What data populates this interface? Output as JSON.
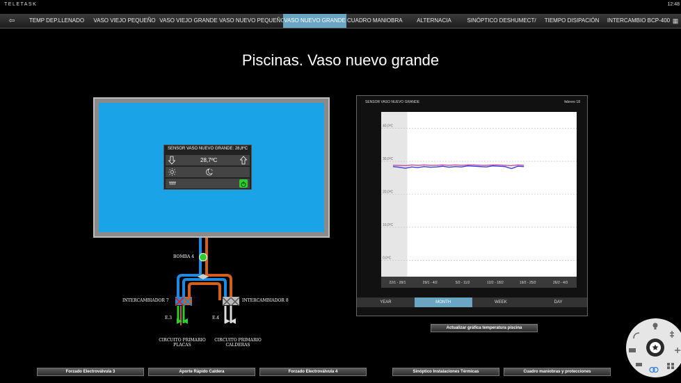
{
  "brand": "TELETASK",
  "clock": "12:48",
  "nav": {
    "tabs": [
      {
        "label": "TEMP DEP.LLENADO",
        "active": false
      },
      {
        "label": "VASO VIEJO PEQUEÑO",
        "active": false
      },
      {
        "label": "VASO VIEJO GRANDE",
        "active": false
      },
      {
        "label": "VASO NUEVO PEQUEÑO",
        "active": false
      },
      {
        "label": "VASO NUEVO GRANDE",
        "active": true
      },
      {
        "label": "CUADRO MANIOBRAS",
        "active": false
      },
      {
        "label": "ALTERNACIA",
        "active": false
      },
      {
        "label": "SINÓPTICO DESHUMECT/",
        "active": false
      },
      {
        "label": "TIEMPO DISIPACIÓN",
        "active": false
      },
      {
        "label": "INTERCAMBIO BCP-400",
        "active": false
      }
    ]
  },
  "page_title": "Piscinas. Vaso nuevo grande",
  "widget": {
    "title": "SENSOR VASO NUEVO GRANDE: 28,8ºC",
    "setpoint": "28,7ºC",
    "colors": {
      "power": "#2ecc2e",
      "bg": "#222222"
    }
  },
  "schematic": {
    "pump": "BOMBA 4",
    "hx7": "INTERCAMBIADOR 7",
    "hx8": "INTERCAMBIADOR 8",
    "e3": "E.3",
    "e4": "E.4",
    "circuit_a": [
      "CIRCUITO PRIMARIO",
      "PLACAS"
    ],
    "circuit_b": [
      "CIRCUITO PRIMARIO",
      "CALDERAS"
    ],
    "colors": {
      "hot": "#d2601c",
      "cold": "#1e8be0",
      "water": "#1aa3e6"
    }
  },
  "chart": {
    "header_left": "SENSOR VASO NUEVO GRANDE",
    "header_right": "febrero 18",
    "range_buttons": [
      {
        "label": "YEAR",
        "active": false
      },
      {
        "label": "MONTH",
        "active": true
      },
      {
        "label": "WEEK",
        "active": false
      },
      {
        "label": "DAY",
        "active": false
      }
    ]
  },
  "chart_data": {
    "type": "line",
    "ylim": [
      -5,
      45
    ],
    "yticks": [
      {
        "v": 40,
        "t": "40,0ºC"
      },
      {
        "v": 30,
        "t": "30,0ºC"
      },
      {
        "v": 20,
        "t": "20,0ºC"
      },
      {
        "v": 10,
        "t": "10,0ºC"
      },
      {
        "v": 0,
        "t": "0,0ºC"
      }
    ],
    "categories": [
      "22/1 - 28/1",
      "29/1 - 4/2",
      "5/2 - 11/2",
      "12/2 - 18/2",
      "19/2 - 25/2",
      "26/2 - 4/3"
    ],
    "series": [
      {
        "color": "#3a3ae0",
        "values": [
          28.4,
          28.2,
          27.9,
          28.3,
          28.1,
          28.4,
          28.2,
          28.3,
          28.5,
          28.2,
          28.4,
          28.3,
          28.6,
          28.5,
          28.4,
          28.3,
          28.6,
          28.5,
          28.4,
          27.8,
          28.5,
          28.4
        ]
      },
      {
        "color": "#c04a9a",
        "values": [
          28.8,
          28.8,
          28.7,
          28.9,
          28.8,
          28.9,
          28.8,
          28.8,
          28.9,
          28.8,
          28.9,
          28.8,
          28.9,
          28.9,
          28.8,
          28.8,
          28.9,
          28.9,
          28.8,
          28.7,
          28.9,
          28.8
        ]
      }
    ]
  },
  "actions": {
    "update_chart": "Actualizar gráfica temperatura piscina",
    "forzado3": "Forzado Electroválvula 3",
    "aporte": "Aporte Rápido Caldera",
    "forzado4": "Forzado Electroválvula 4",
    "sinoptico": "Sinóptico Instalaciones Térmicas",
    "cuadro": "Cuadro maniobras y protecciones"
  }
}
